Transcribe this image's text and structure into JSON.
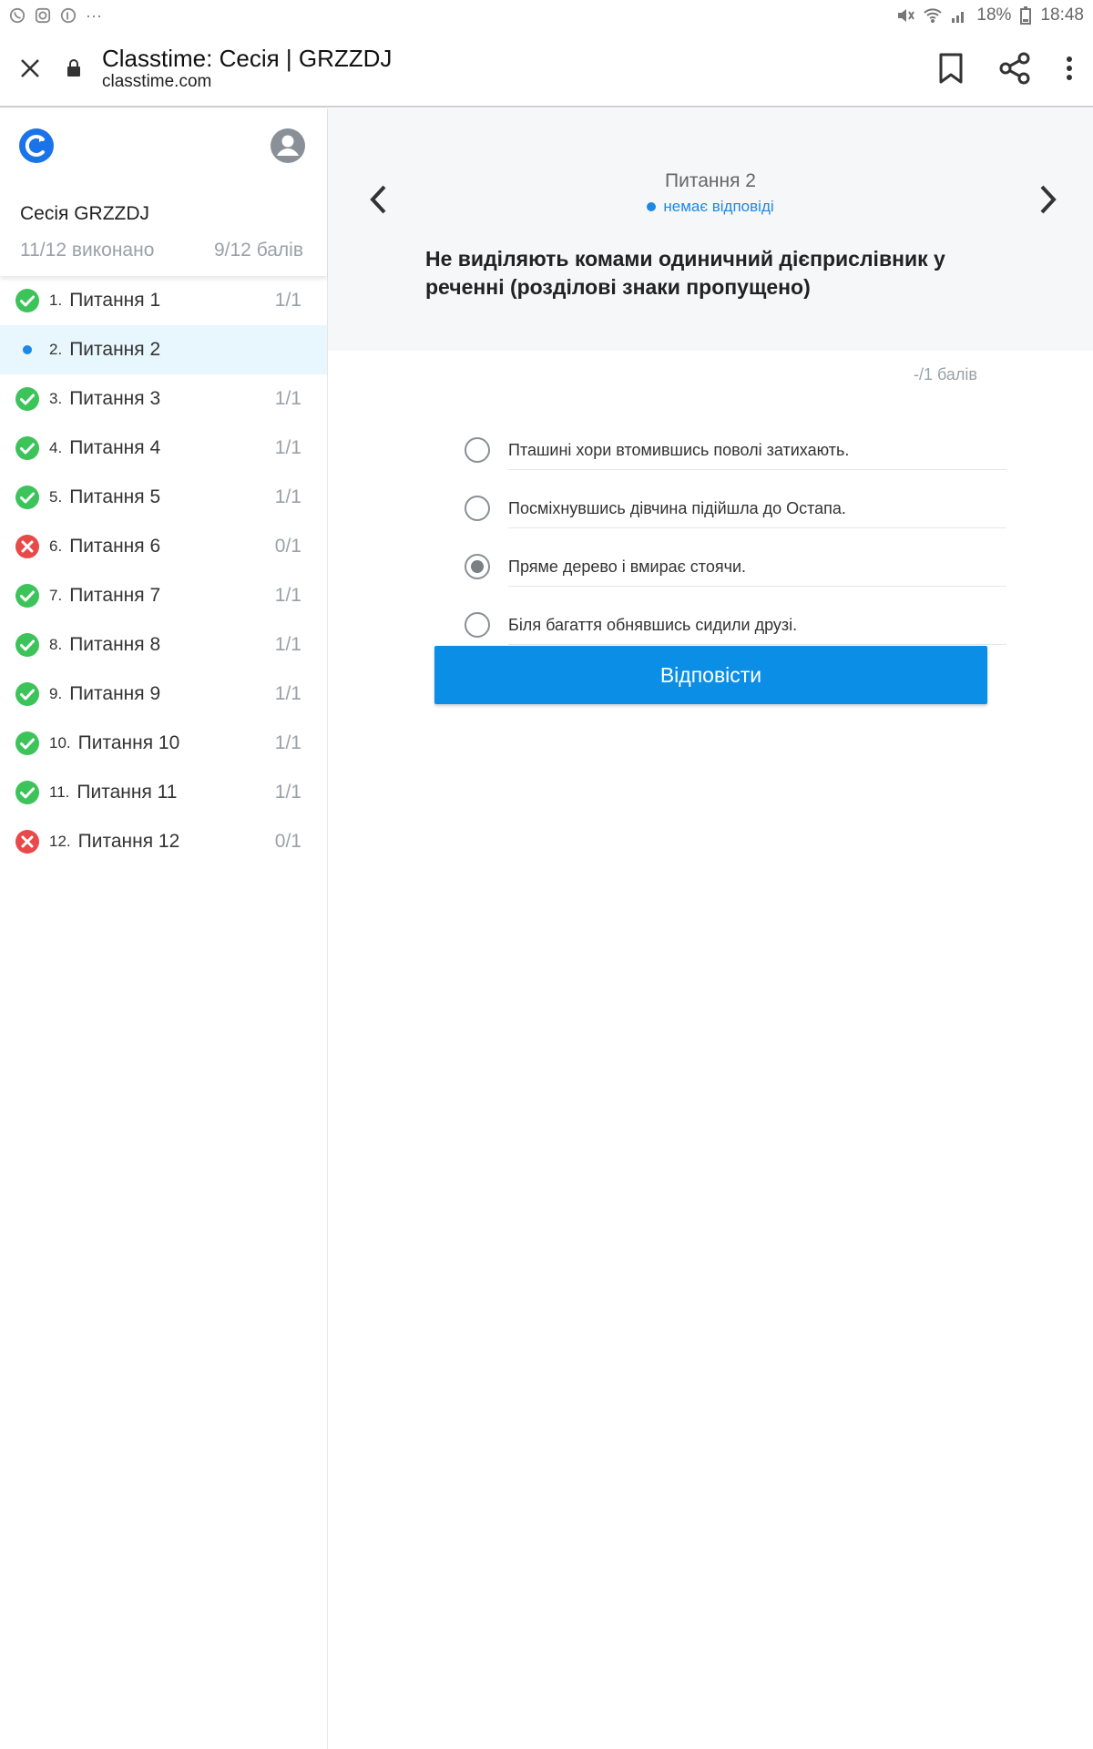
{
  "status_bar": {
    "left_icons": [
      "viber-icon",
      "instagram-icon",
      "pinterest-icon"
    ],
    "more": "···",
    "battery": "18%",
    "time": "18:48"
  },
  "browser": {
    "title": "Classtime: Сесія | GRZZDJ",
    "url": "classtime.com"
  },
  "sidebar": {
    "session_name": "Сесія GRZZDJ",
    "completed": "11/12 виконано",
    "score": "9/12 балів",
    "questions": [
      {
        "num": "1.",
        "label": "Питання 1",
        "score": "1/1",
        "status": "correct"
      },
      {
        "num": "2.",
        "label": "Питання 2",
        "score": "",
        "status": "current"
      },
      {
        "num": "3.",
        "label": "Питання 3",
        "score": "1/1",
        "status": "correct"
      },
      {
        "num": "4.",
        "label": "Питання 4",
        "score": "1/1",
        "status": "correct"
      },
      {
        "num": "5.",
        "label": "Питання 5",
        "score": "1/1",
        "status": "correct"
      },
      {
        "num": "6.",
        "label": "Питання 6",
        "score": "0/1",
        "status": "wrong"
      },
      {
        "num": "7.",
        "label": "Питання 7",
        "score": "1/1",
        "status": "correct"
      },
      {
        "num": "8.",
        "label": "Питання 8",
        "score": "1/1",
        "status": "correct"
      },
      {
        "num": "9.",
        "label": "Питання 9",
        "score": "1/1",
        "status": "correct"
      },
      {
        "num": "10.",
        "label": "Питання 10",
        "score": "1/1",
        "status": "correct"
      },
      {
        "num": "11.",
        "label": "Питання 11",
        "score": "1/1",
        "status": "correct"
      },
      {
        "num": "12.",
        "label": "Питання 12",
        "score": "0/1",
        "status": "wrong"
      }
    ]
  },
  "question": {
    "title": "Питання 2",
    "state": "немає відповіді",
    "text": "Не виділяють комами одиничний дієприслівник у реченні (розділові знаки пропущено)",
    "points": "-/1 балів",
    "options": [
      {
        "text": "Пташині хори втомившись поволі затихають.",
        "selected": false
      },
      {
        "text": "Посміхнувшись дівчина підійшла до Остапа.",
        "selected": false
      },
      {
        "text": "Пряме дерево і вмирає стоячи.",
        "selected": true
      },
      {
        "text": "Біля багаття обнявшись сидили друзі.",
        "selected": false
      }
    ],
    "answer_button": "Відповісти"
  },
  "colors": {
    "accent": "#0b8ee6",
    "correct": "#3cc45a",
    "wrong": "#e84a4a",
    "current": "#1e88e5",
    "active_row": "#e8f6fd"
  }
}
